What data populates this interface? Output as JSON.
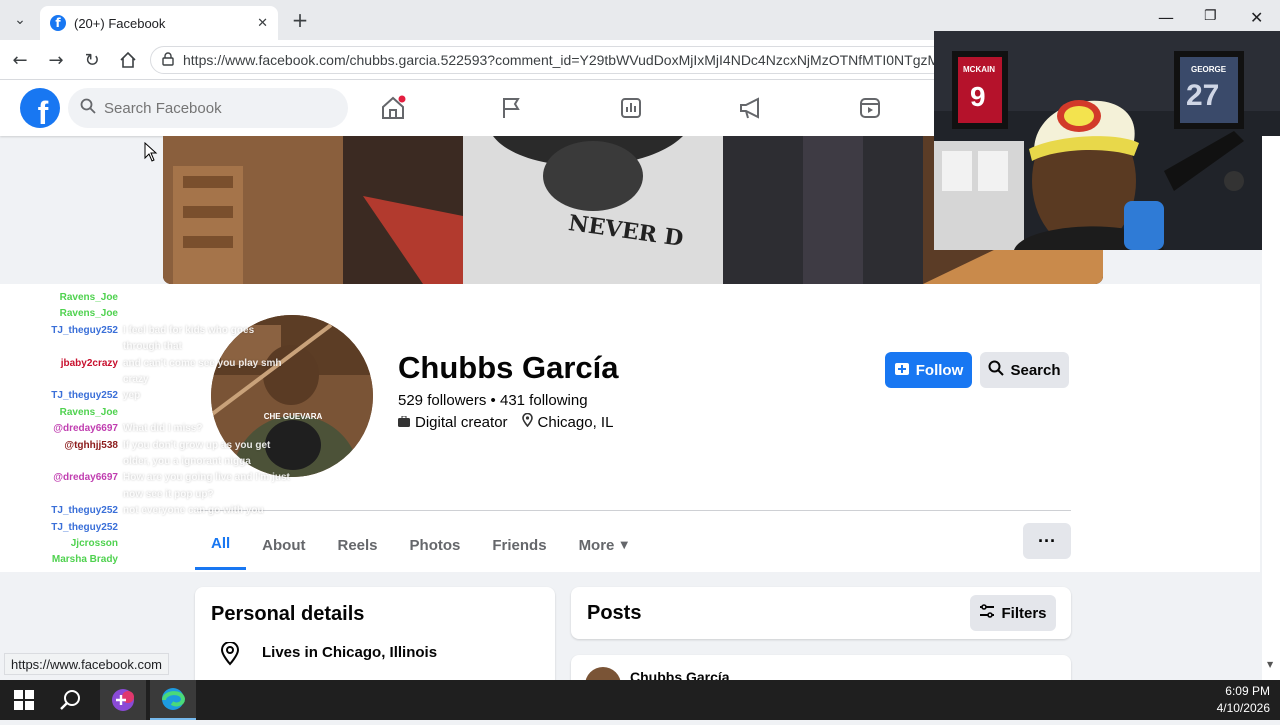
{
  "browser": {
    "tab_title": "(20+) Facebook",
    "tab_close": "✕",
    "new_tab": "+",
    "url": "https://www.facebook.com/chubbs.garcia.522593?comment_id=Y29tbWVudDoxMjIxMjI4NDc4NzcxNjMzOTNfMTI0NTgzMT",
    "status_url": "https://www.facebook.com"
  },
  "facebook": {
    "logo_letter": "f",
    "search_placeholder": "Search Facebook"
  },
  "profile": {
    "name": "Chubbs García",
    "followers": "529 followers",
    "following": "431 following",
    "separator": " • ",
    "category": "Digital creator",
    "location": "Chicago, IL",
    "follow_label": "Follow",
    "search_label": "Search",
    "more_dots": "···",
    "cover_text": "NEVER D",
    "avatar_shirt_text": "CHE GUEVARA"
  },
  "tabs": [
    {
      "label": "All"
    },
    {
      "label": "About"
    },
    {
      "label": "Reels"
    },
    {
      "label": "Photos"
    },
    {
      "label": "Friends"
    },
    {
      "label": "More"
    }
  ],
  "details": {
    "title": "Personal details",
    "lives_in": "Lives in Chicago, Illinois"
  },
  "posts": {
    "title": "Posts",
    "filters_label": "Filters",
    "first_author": "Chubbs García"
  },
  "chat": [
    {
      "user": "Ravens_Joe",
      "color": "#4fd24f",
      "text": ""
    },
    {
      "user": "Ravens_Joe",
      "color": "#4fd24f",
      "text": ""
    },
    {
      "user": "TJ_theguy252",
      "color": "#3a6fd8",
      "text": "I feel bad for kids who goes"
    },
    {
      "user": "",
      "color": "#3a6fd8",
      "text": "through that"
    },
    {
      "user": "jbaby2crazy",
      "color": "#c8102e",
      "text": "and can't come see you play smh"
    },
    {
      "user": "",
      "color": "#c8102e",
      "text": "crazy"
    },
    {
      "user": "TJ_theguy252",
      "color": "#3a6fd8",
      "text": "yep"
    },
    {
      "user": "Ravens_Joe",
      "color": "#4fd24f",
      "text": ""
    },
    {
      "user": "@dreday6697",
      "color": "#c03eb0",
      "text": "What did I miss?"
    },
    {
      "user": "@tghhjj538",
      "color": "#8b1a1a",
      "text": "If you don't grow up as you get"
    },
    {
      "user": "",
      "color": "#8b1a1a",
      "text": "older, you a ignorant nigga"
    },
    {
      "user": "@dreday6697",
      "color": "#c03eb0",
      "text": "How are you going live and I'm just"
    },
    {
      "user": "",
      "color": "#c03eb0",
      "text": "now see it pop up?"
    },
    {
      "user": "TJ_theguy252",
      "color": "#3a6fd8",
      "text": "not everyone can go with you"
    },
    {
      "user": "TJ_theguy252",
      "color": "#3a6fd8",
      "text": ""
    },
    {
      "user": "Jjcrosson",
      "color": "#4fd24f",
      "text": ""
    },
    {
      "user": "Marsha Brady",
      "color": "#4fd24f",
      "text": ""
    }
  ],
  "webcam": {
    "jersey_left_name": "MCKAIN",
    "jersey_left_number": "9",
    "jersey_right_name": "GEORGE",
    "jersey_right_number": "27"
  },
  "taskbar": {
    "time": "6:09 PM",
    "date": "4/10/2026"
  },
  "colors": {
    "fb_blue": "#1877f2",
    "fb_bg": "#f0f2f5",
    "taskbar": "#1f1f1f"
  }
}
